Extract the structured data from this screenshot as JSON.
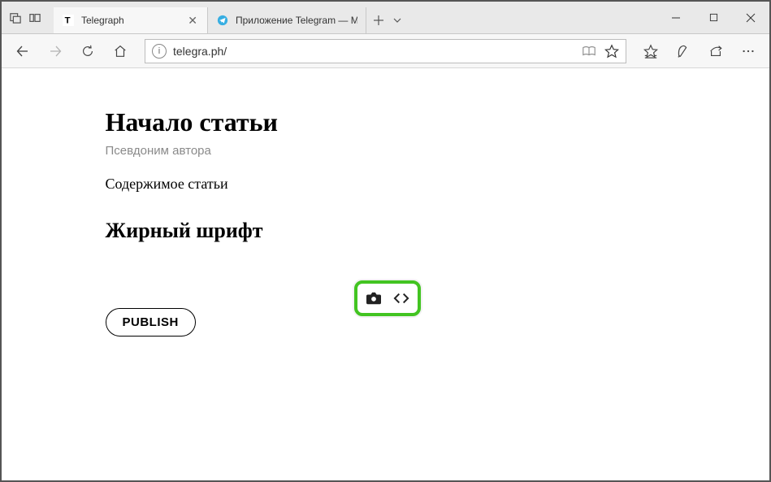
{
  "window": {
    "tabs": [
      {
        "title": "Telegraph",
        "active": true
      },
      {
        "title": "Приложение Telegram — М",
        "active": false
      }
    ]
  },
  "addressbar": {
    "url": "telegra.ph/"
  },
  "article": {
    "title": "Начало статьи",
    "author": "Псевдоним автора",
    "body": "Содержимое статьи",
    "heading": "Жирный шрифт"
  },
  "actions": {
    "publish": "PUBLISH"
  }
}
